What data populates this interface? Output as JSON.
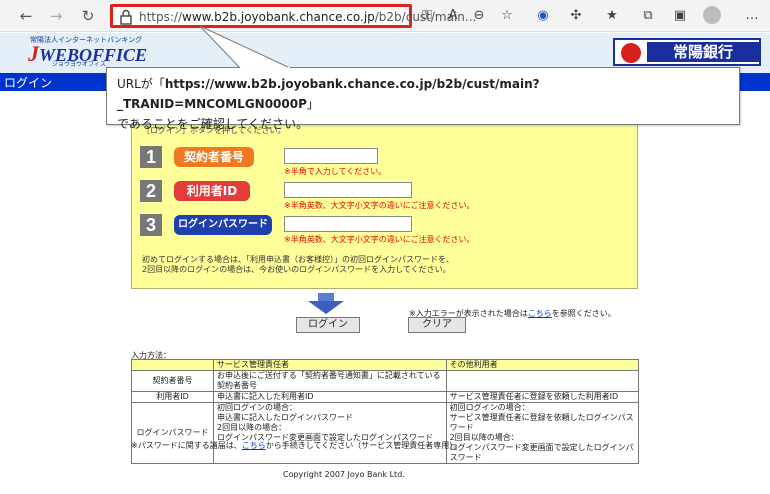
{
  "browser": {
    "url_prefix": "https://",
    "url_host": "www.b2b.joyobank.chance.co.jp",
    "url_rest": "/b2b/cust/main..."
  },
  "header": {
    "logo_tagline": "常陽法人インターネットバンキング",
    "logo_text": "WEBOFFICE",
    "logo_sub": "ジョウヨウオフィス",
    "bank_name": "常陽銀行"
  },
  "login_bar": {
    "title": "ログイン"
  },
  "callout": {
    "line1_prefix": "URLが「",
    "line1_url": "https://www.b2b.joyobank.chance.co.jp/b2b/cust/main?_TRANID=MNCOMLGN0000P",
    "line1_suffix": "」",
    "line2": "であることをご確認してください。"
  },
  "login_form": {
    "hint": "［ログイン］ボタンを押してください。",
    "fields": [
      {
        "num": "1",
        "label": "契約者番号",
        "note": "※半角で入力してください。",
        "value": ""
      },
      {
        "num": "2",
        "label": "利用者ID",
        "note": "※半角英数、大文字小文字の違いにご注意ください。",
        "value": ""
      },
      {
        "num": "3",
        "label": "ログインパスワード",
        "note": "※半角英数、大文字小文字の違いにご注意ください。",
        "value": ""
      }
    ],
    "footer_line1": "初めてログインする場合は、「利用申込書（お客様控）」の初回ログインパスワードを、",
    "footer_line2": "2回目以降のログインの場合は、今お使いのログインパスワードを入力してください。"
  },
  "buttons": {
    "login": "ログイン",
    "clear": "クリア",
    "err_prefix": "※入力エラーが表示された場合は",
    "err_link": "こちら",
    "err_suffix": "を参照ください。"
  },
  "info_table": {
    "caption": "入力方法：",
    "headers": [
      "",
      "サービス管理責任者",
      "その他利用者"
    ],
    "rows": [
      {
        "label": "契約者番号",
        "admin": "お申込後にご送付する「契約者番号通知書」に記載されている契約者番号",
        "other": ""
      },
      {
        "label": "利用者ID",
        "admin": "申込書に記入した利用者ID",
        "other": "サービス管理責任者に登録を依頼した利用者ID"
      },
      {
        "label": "ログインパスワード",
        "admin": [
          "初回ログインの場合：",
          "申込書に記入したログインパスワード",
          "2回目以降の場合：",
          "ログインパスワード変更画面で設定したログインパスワード"
        ],
        "other": [
          "初回ログインの場合：",
          "サービス管理責任者に登録を依頼したログインパスワード",
          "2回目以降の場合：",
          "ログインパスワード変更画面で設定したログインパスワード"
        ]
      }
    ]
  },
  "pw_note": {
    "prefix": "※パスワードに関する諸届は、",
    "link": "こちら",
    "suffix": "から手続きしてください（サービス管理責任者専用）。"
  },
  "copyright": "Copyright 2007 Joyo Bank Ltd."
}
